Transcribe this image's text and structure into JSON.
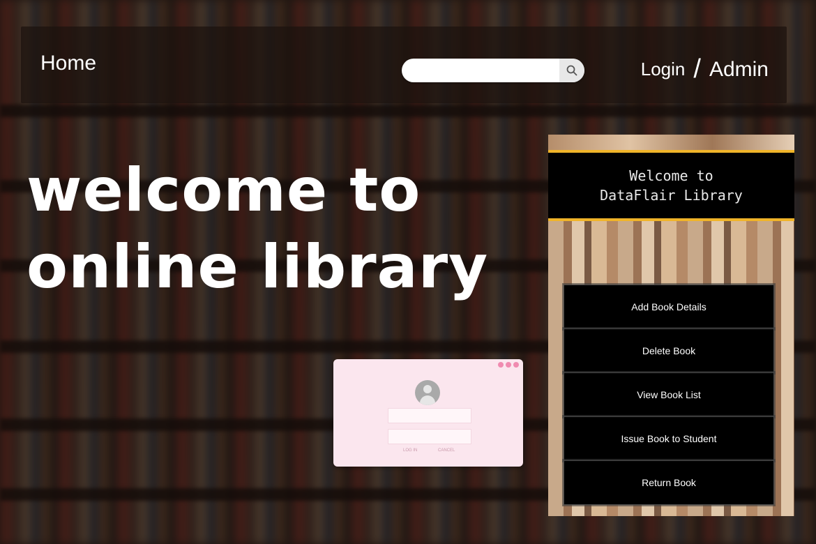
{
  "navbar": {
    "home_label": "Home",
    "search_placeholder": "",
    "login_label": "Login",
    "separator": "/",
    "admin_label": "Admin"
  },
  "hero": {
    "line1": "welcome to",
    "line2": "online library"
  },
  "login_mockup": {
    "login_button": "LOG IN",
    "cancel_button": "CANCEL"
  },
  "app_panel": {
    "title_line1": "Welcome to",
    "title_line2": "DataFlair Library",
    "menu": [
      {
        "label": "Add Book Details"
      },
      {
        "label": "Delete Book"
      },
      {
        "label": "View Book List"
      },
      {
        "label": "Issue Book to Student"
      },
      {
        "label": "Return Book"
      }
    ],
    "header_bar_color": "#000000",
    "accent_color": "#f0b429"
  }
}
